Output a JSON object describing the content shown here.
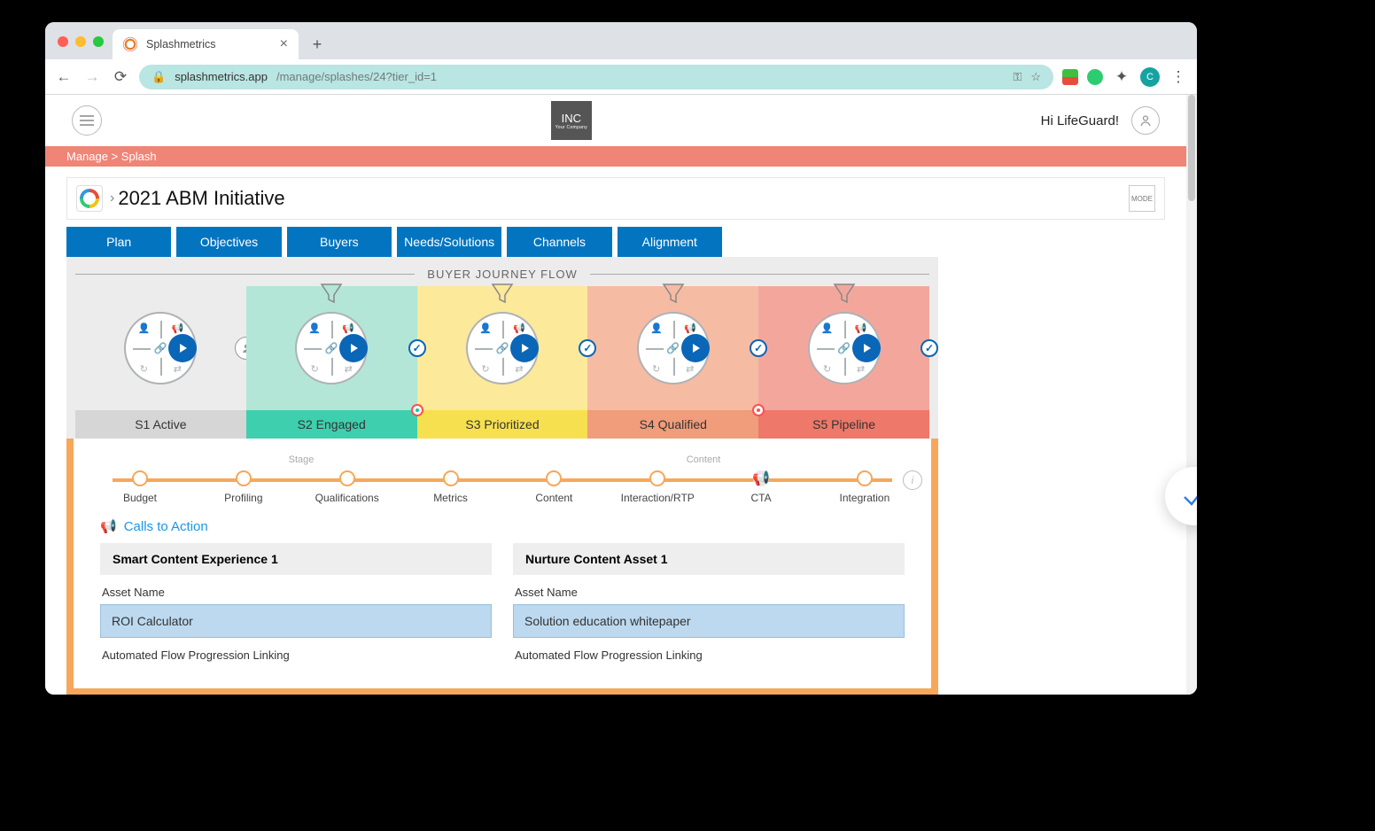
{
  "browser": {
    "tab_title": "Splashmetrics",
    "url_host": "splashmetrics.app",
    "url_path": "/manage/splashes/24?tier_id=1"
  },
  "header": {
    "logo": "INC",
    "logo_sub": "Your Company",
    "greeting": "Hi LifeGuard!"
  },
  "breadcrumb": "Manage > Splash",
  "page": {
    "title": "2021 ABM Initiative",
    "mode_btn": "MODE"
  },
  "nav": [
    "Plan",
    "Objectives",
    "Buyers",
    "Needs/Solutions",
    "Channels",
    "Alignment"
  ],
  "bjf": {
    "title": "BUYER JOURNEY FLOW",
    "stages": [
      "S1 Active",
      "S2 Engaged",
      "S3 Prioritized",
      "S4 Qualified",
      "S5 Pipeline"
    ]
  },
  "substeps": {
    "group0": "Stage",
    "group1": "Content",
    "items": [
      "Budget",
      "Profiling",
      "Qualifications",
      "Metrics",
      "Content",
      "Interaction/RTP",
      "CTA",
      "Integration"
    ]
  },
  "cta": {
    "heading": "Calls to Action"
  },
  "cards": [
    {
      "title": "Smart Content Experience 1",
      "asset_label": "Asset Name",
      "asset_value": "ROI Calculator",
      "flow_label": "Automated Flow Progression Linking"
    },
    {
      "title": "Nurture Content Asset 1",
      "asset_label": "Asset Name",
      "asset_value": "Solution education whitepaper",
      "flow_label": "Automated Flow Progression Linking"
    }
  ]
}
